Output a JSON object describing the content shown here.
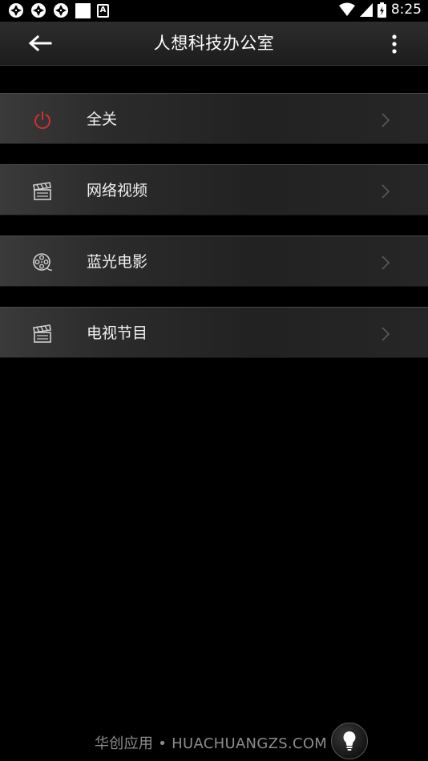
{
  "status_bar": {
    "time": "8:25",
    "icons_left": [
      "aperture-icon",
      "aperture-icon",
      "aperture-icon",
      "white-square-icon",
      "a-badge-icon"
    ],
    "a_badge_text": "A",
    "icons_right": [
      "wifi-icon",
      "cell-signal-icon",
      "battery-icon"
    ]
  },
  "app_bar": {
    "title": "人想科技办公室",
    "back_icon": "arrow-left-icon",
    "menu_icon": "more-vert-icon"
  },
  "list": {
    "items": [
      {
        "label": "全关",
        "icon": "power-icon",
        "icon_color": "#d32f2f"
      },
      {
        "label": "网络视频",
        "icon": "clapperboard-icon",
        "icon_color": "#d0d0d0"
      },
      {
        "label": "蓝光电影",
        "icon": "film-reel-icon",
        "icon_color": "#d0d0d0"
      },
      {
        "label": "电视节目",
        "icon": "clapperboard-icon",
        "icon_color": "#d0d0d0"
      }
    ],
    "chevron_icon": "chevron-right-icon"
  },
  "footer": {
    "text": "华创应用 • HUACHUANGZS.COM",
    "bulb_icon": "lightbulb-icon"
  },
  "colors": {
    "background": "#000000",
    "app_bar": "#262626",
    "row": "#2b2b2b",
    "power_red": "#d32f2f",
    "footer_text": "#8c8c8c"
  }
}
